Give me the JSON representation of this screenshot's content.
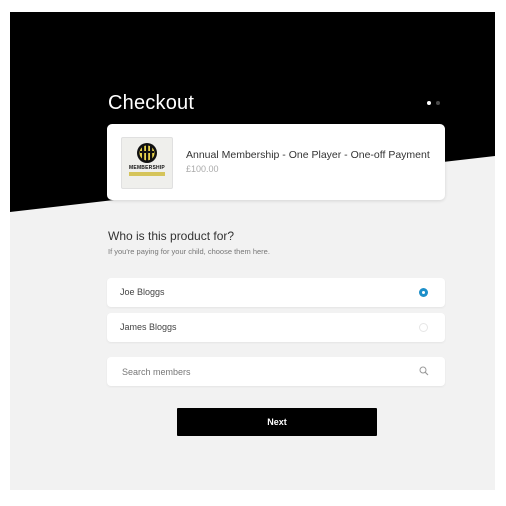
{
  "header": {
    "title": "Checkout",
    "steps": 2,
    "active_step": 1
  },
  "product": {
    "name": "Annual Membership - One Player - One-off Payment",
    "price": "£100.00",
    "thumbnail_text": "MEMBERSHIP"
  },
  "selection": {
    "question": "Who is this product for?",
    "hint": "If you're paying for your child, choose them here.",
    "options": [
      {
        "label": "Joe Bloggs",
        "selected": true
      },
      {
        "label": "James Bloggs",
        "selected": false
      }
    ]
  },
  "search": {
    "placeholder": "Search members",
    "value": ""
  },
  "actions": {
    "next_label": "Next"
  },
  "colors": {
    "hero_bg": "#000000",
    "page_bg": "#f2f2f2",
    "radio_selected": "#1d8fc9",
    "button_bg": "#000000"
  }
}
